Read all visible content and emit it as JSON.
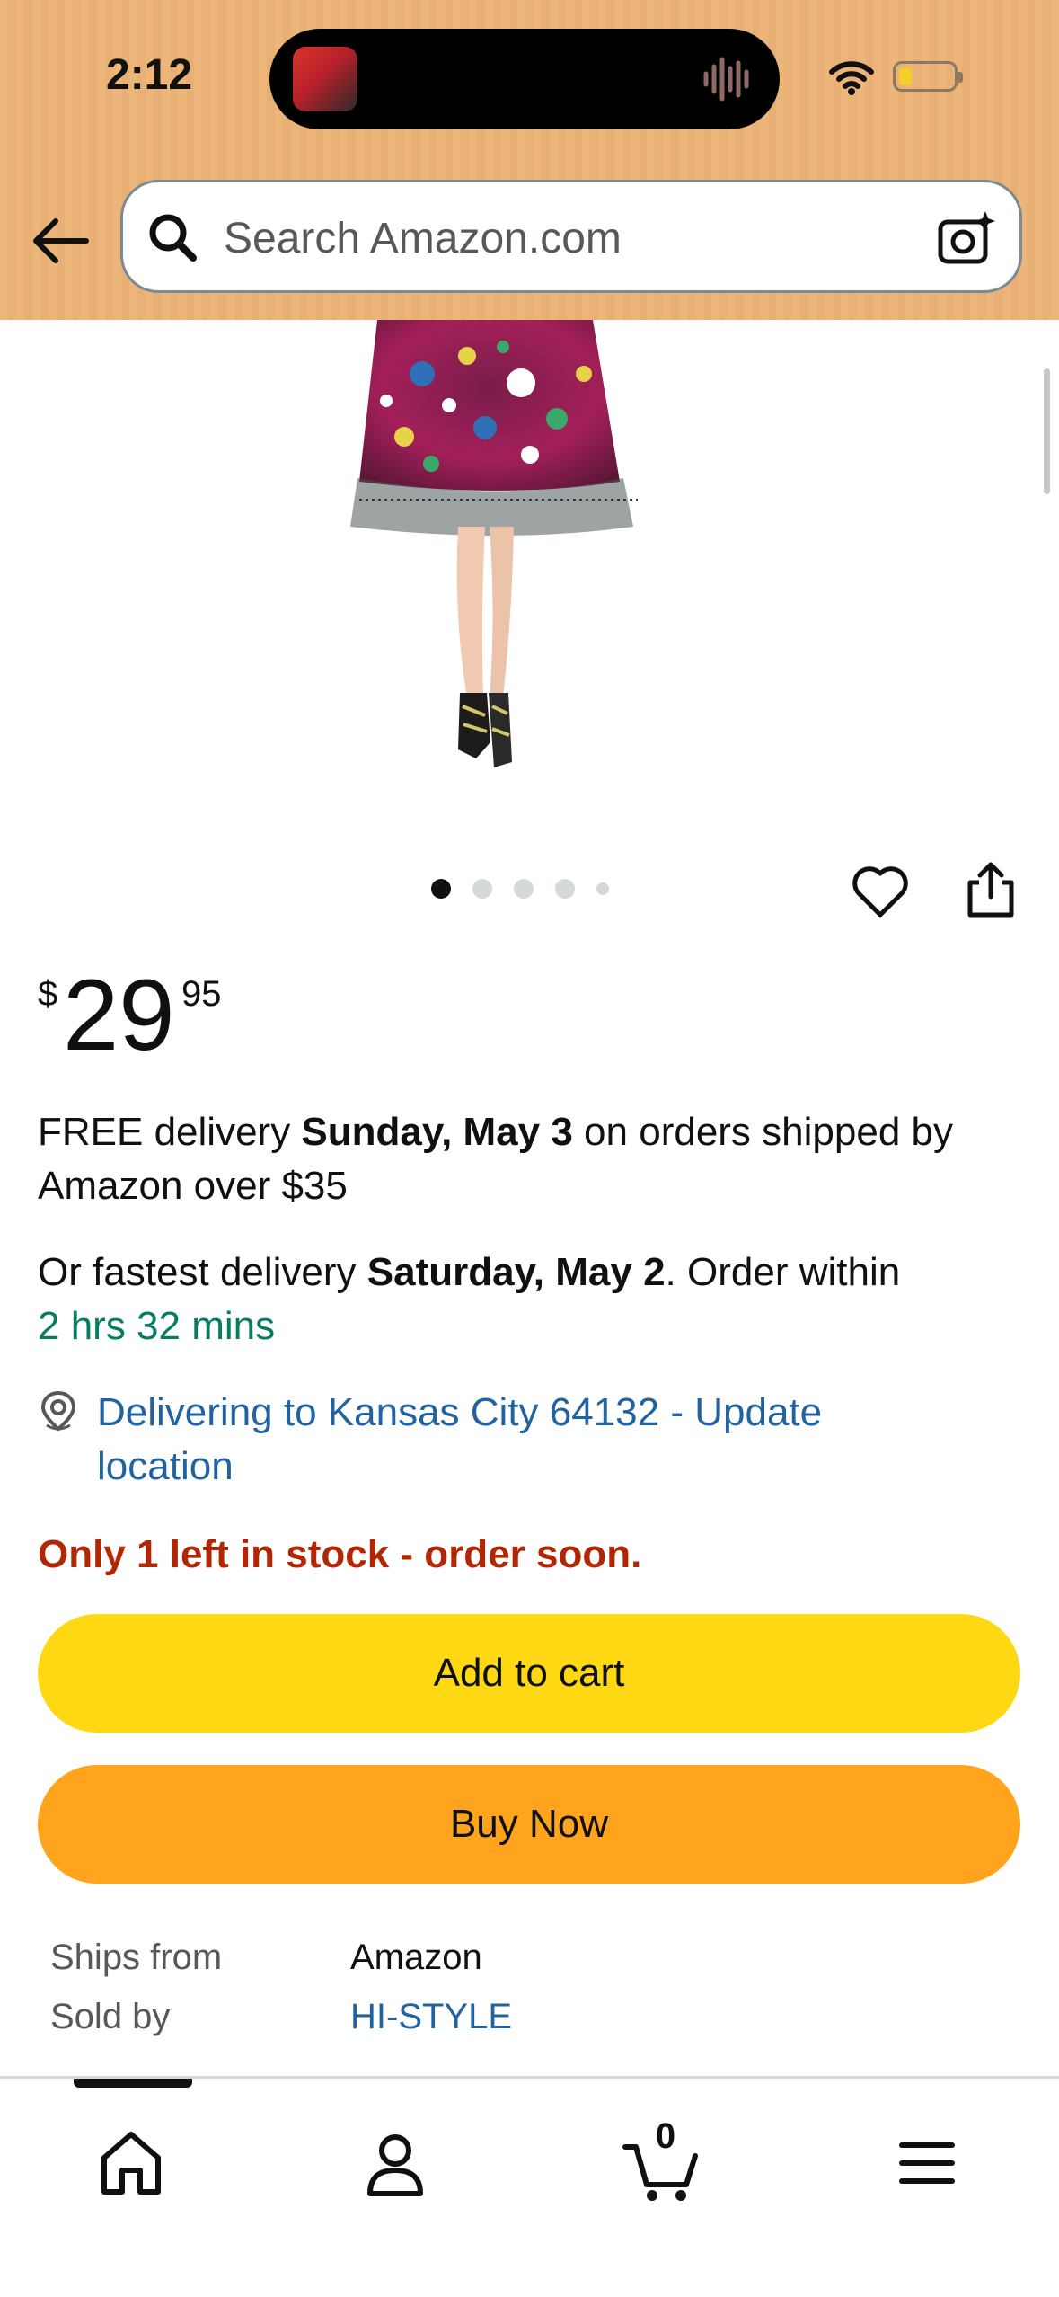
{
  "status_bar": {
    "time": "2:12"
  },
  "header": {
    "search_placeholder": "Search Amazon.com",
    "accent_color": "#ecb57a"
  },
  "carousel": {
    "dot_count": 5,
    "active_index": 0
  },
  "price": {
    "symbol": "$",
    "whole": "29",
    "fraction": "95"
  },
  "delivery": {
    "free_prefix": "FREE delivery ",
    "free_date": "Sunday, May 3",
    "free_suffix": " on orders shipped by Amazon over $35",
    "fast_prefix": "Or fastest delivery ",
    "fast_date": "Saturday, May 2",
    "fast_suffix": ". Order within ",
    "countdown": "2 hrs 32 mins"
  },
  "location": {
    "text": "Delivering to Kansas City 64132 - Update location"
  },
  "stock_message": "Only 1 left in stock - order soon.",
  "buttons": {
    "add_to_cart": "Add to cart",
    "buy_now": "Buy Now"
  },
  "info": {
    "ships_from_label": "Ships from",
    "ships_from_value": "Amazon",
    "sold_by_label": "Sold by",
    "sold_by_value": "HI-STYLE"
  },
  "bottom_nav": {
    "cart_count": "0"
  },
  "colors": {
    "add_to_cart": "#ffd814",
    "buy_now": "#ffa41c",
    "stock": "#b12704",
    "link": "#2162a1",
    "green": "#067d62"
  }
}
